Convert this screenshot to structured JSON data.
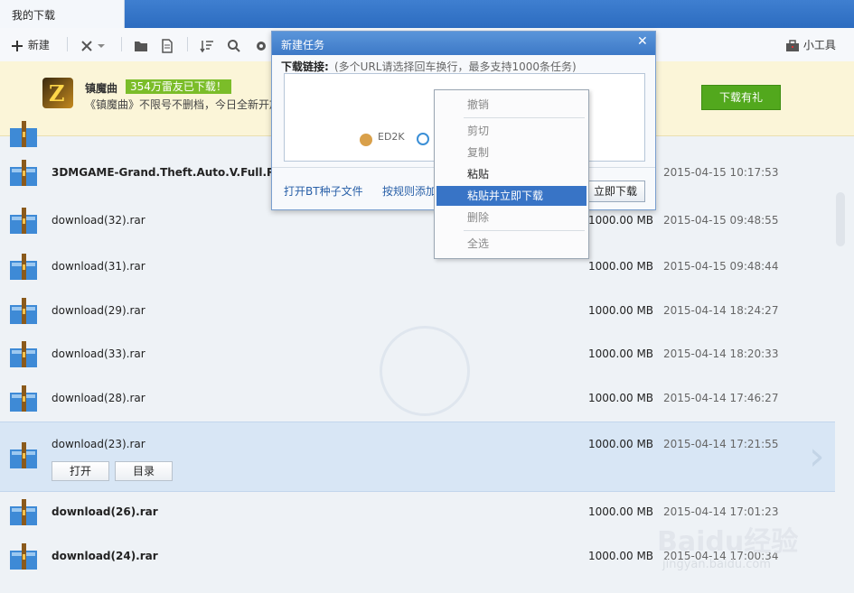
{
  "window": {
    "tab_title": "我的下载"
  },
  "toolbar": {
    "new_label": "新建",
    "tools_label": "小工具"
  },
  "banner": {
    "game_title": "镇魔曲",
    "badge": "354万雷友已下载！",
    "description": "《镇魔曲》不限号不删档，今日全新开放",
    "gift_button": "下载有礼",
    "logo_letter": "Z"
  },
  "downloads": [
    {
      "name": "3DMGAME-Grand.Theft.Auto.V.Full.Retail.",
      "size": "",
      "time": "2015-04-15 10:17:53",
      "bold": true
    },
    {
      "name": "download(32).rar",
      "size": "1000.00 MB",
      "time": "2015-04-15 09:48:55",
      "bold": false
    },
    {
      "name": "download(31).rar",
      "size": "1000.00 MB",
      "time": "2015-04-15 09:48:44",
      "bold": false
    },
    {
      "name": "download(29).rar",
      "size": "1000.00 MB",
      "time": "2015-04-14 18:24:27",
      "bold": false
    },
    {
      "name": "download(33).rar",
      "size": "1000.00 MB",
      "time": "2015-04-14 18:20:33",
      "bold": false
    },
    {
      "name": "download(28).rar",
      "size": "1000.00 MB",
      "time": "2015-04-14 17:46:27",
      "bold": false
    },
    {
      "name": "download(23).rar",
      "size": "1000.00 MB",
      "time": "2015-04-14 17:21:55",
      "bold": false,
      "selected": true
    },
    {
      "name": "download(26).rar",
      "size": "1000.00 MB",
      "time": "2015-04-14 17:01:23",
      "bold": true
    },
    {
      "name": "download(24).rar",
      "size": "1000.00 MB",
      "time": "2015-04-14 17:00:34",
      "bold": true
    }
  ],
  "selected_actions": {
    "open": "打开",
    "folder": "目录"
  },
  "dialog": {
    "title": "新建任务",
    "close": "✕",
    "link_label": "下载链接:",
    "link_hint": "(多个URL请选择回车换行，最多支持1000条任务)",
    "ed2k": "ED2K",
    "open_bt": "打开BT种子文件",
    "rule_add": "按规则添加",
    "download_now": "立即下载"
  },
  "context_menu": [
    {
      "label": "撤销",
      "state": "disabled"
    },
    {
      "label": "剪切",
      "state": "disabled"
    },
    {
      "label": "复制",
      "state": "disabled"
    },
    {
      "label": "粘贴",
      "state": "normal"
    },
    {
      "label": "粘贴并立即下载",
      "state": "active"
    },
    {
      "label": "删除",
      "state": "disabled"
    },
    {
      "label": "全选",
      "state": "disabled"
    }
  ],
  "watermark": {
    "brand": "Baidu经验",
    "url": "jingyan.baidu.com"
  },
  "colors": {
    "accent": "#3874c6",
    "title_bar": "#2c6cc0",
    "banner_bg": "#fbf5d8",
    "gift_green": "#52a81d"
  }
}
